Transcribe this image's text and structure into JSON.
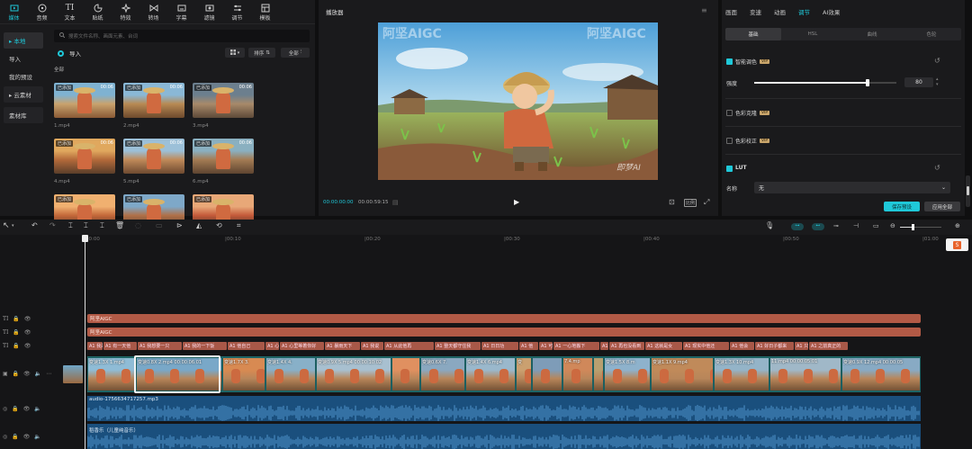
{
  "top_tools": [
    {
      "label": "媒体",
      "icon": "media-icon",
      "active": true
    },
    {
      "label": "音频",
      "icon": "audio-icon"
    },
    {
      "label": "文本",
      "icon": "text-icon"
    },
    {
      "label": "贴纸",
      "icon": "sticker-icon"
    },
    {
      "label": "特效",
      "icon": "effects-icon"
    },
    {
      "label": "转场",
      "icon": "transition-icon"
    },
    {
      "label": "字幕",
      "icon": "subtitle-icon"
    },
    {
      "label": "滤镜",
      "icon": "filter-icon"
    },
    {
      "label": "调节",
      "icon": "adjust-icon"
    },
    {
      "label": "模板",
      "icon": "template-icon"
    }
  ],
  "sidenav": [
    {
      "label": "▸ 本地",
      "active": true
    },
    {
      "label": "导入"
    },
    {
      "label": "我的预设"
    },
    {
      "label": "▸ 云素材"
    },
    {
      "label": "素材库"
    }
  ],
  "media": {
    "search_placeholder": "搜索文件名称、画面元素、台词",
    "import_label": "导入",
    "sort_label": "排序",
    "filter_label": "全部",
    "section_label": "全部",
    "items": [
      {
        "name": "1.mp4",
        "tag": "已添加",
        "dur": "00:06"
      },
      {
        "name": "2.mp4",
        "tag": "已添加",
        "dur": "00:06"
      },
      {
        "name": "3.mp4",
        "tag": "已添加",
        "dur": "00:06"
      },
      {
        "name": "4.mp4",
        "tag": "已添加",
        "dur": "00:06"
      },
      {
        "name": "5.mp4",
        "tag": "已添加",
        "dur": "00:06"
      },
      {
        "name": "6.mp4",
        "tag": "已添加",
        "dur": "00:06"
      },
      {
        "name": "",
        "tag": "已添加",
        "dur": ""
      },
      {
        "name": "",
        "tag": "已添加",
        "dur": ""
      },
      {
        "name": "",
        "tag": "已添加",
        "dur": ""
      }
    ]
  },
  "player": {
    "title": "播放器",
    "watermark1": "阿坚AIGC",
    "watermark2": "阿坚AIGC",
    "watermark3": "即梦AI",
    "current_time": "00:00:00:00",
    "total_time": "00:00:59:15",
    "ratio_label": "比例"
  },
  "right": {
    "tabs": [
      {
        "label": "画面"
      },
      {
        "label": "变速"
      },
      {
        "label": "动画"
      },
      {
        "label": "调节",
        "active": true
      },
      {
        "label": "AI效果"
      }
    ],
    "subtabs": [
      {
        "label": "基础",
        "active": true
      },
      {
        "label": "HSL"
      },
      {
        "label": "曲线"
      },
      {
        "label": "色轮"
      }
    ],
    "smart_color": "智能调色",
    "vip": "VIP",
    "strength_label": "强度",
    "strength_value": "80",
    "strength_fraction": 0.8,
    "color_grade": "色彩克隆",
    "color_correct": "色彩校正",
    "lut_label": "LUT",
    "name_label": "名称",
    "name_value": "无",
    "save_preset": "保存预设",
    "apply_all": "应用全部"
  },
  "timeline": {
    "ruler": [
      "00:00",
      "|00:10",
      "|00:20",
      "|00:30",
      "|00:40",
      "|00:50",
      "|01:00"
    ],
    "text_track1": "阿坚AIGC",
    "text_track2": "阿坚AIGC",
    "subtitle_segs": [
      "A1 我是老",
      "A1 有一天他",
      "A1 我想要一只",
      "A1 我的一下饭",
      "A1 他自己",
      "A1 心里我",
      "A1 心里等着你好",
      "A1 暴雨天下",
      "A1 我说",
      "A1 从此他再",
      "A1 整天都守住我",
      "A1 日日功",
      "A1 他",
      "A1 可",
      "A1 一心地搬下",
      "A1 有",
      "A1 再也没看到",
      "A1 这就是女",
      "A1 现实中他还",
      "A1 他会",
      "A1 好日子都来",
      "A1 只",
      "A1 之前真正的"
    ],
    "video_segs": [
      "变速1.3X 1.mp4",
      "变速0.8X 2.mp4 00:00:06:01",
      "变速1.7X 3.",
      "变速1.4X 4.",
      "变速0.9X 5.mp4 00:00:10:02",
      "",
      "变速0.6X 7.",
      "变速1.4X 6.mp4",
      "变",
      "",
      "7.4.mp",
      "",
      "变速1.5X 8.m",
      "变速1.1X 9.mp4",
      "变速1.3X 10.mp4",
      "11.mp4 00:00:05:01",
      "变速0.9X 12.mp4 00:00:05"
    ],
    "audio1": "audio-1756634717257.mp3",
    "audio2": "稻香乐（儿童纯音乐）"
  }
}
